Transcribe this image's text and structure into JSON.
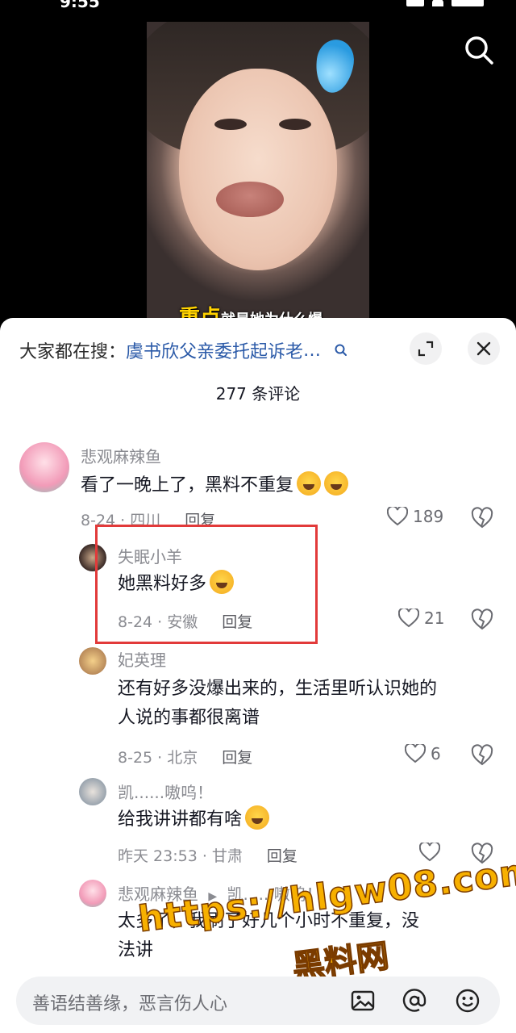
{
  "status": {
    "time": "9:55"
  },
  "video": {
    "caption_highlight": "重点",
    "caption_rest": "就是她为什么爆"
  },
  "sheet": {
    "search_prefix": "大家都在搜：",
    "search_term": "虞书欣父亲委托起诉老",
    "search_ellipsis": "…",
    "comment_count": "277 条评论"
  },
  "comments": [
    {
      "user": "悲观麻辣鱼",
      "text": "看了一晚上了，黑料不重复",
      "date": "8-24 · 四川",
      "reply": "回复",
      "likes": "189"
    },
    {
      "user": "失眠小羊",
      "text": "她黑料好多",
      "date": "8-24 · 安徽",
      "reply": "回复",
      "likes": "21"
    },
    {
      "user": "妃英理",
      "text_line1": "还有好多没爆出来的，生活里听认识她的",
      "text_line2": "人说的事都很离谱",
      "date": "8-25 · 北京",
      "reply": "回复",
      "likes": "6"
    },
    {
      "user": "凯......嗷呜！",
      "text": "给我讲讲都有啥",
      "date": "昨天 23:53 · 甘肃",
      "reply": "回复",
      "likes": ""
    },
    {
      "user": "悲观麻辣鱼",
      "reply_to": "凯......嗷呜！",
      "text_line1": "太多了，我刷了好几个小时不重复，没",
      "text_line2": "法讲"
    }
  ],
  "watermark": {
    "url": "https://hlgw08.com",
    "name": "黑料网"
  },
  "input": {
    "placeholder": "善语结善缘，恶言伤人心"
  },
  "colors": {
    "highlight_box": "#e23a3a",
    "link": "#2b5aa8",
    "watermark": "#f7b000"
  }
}
